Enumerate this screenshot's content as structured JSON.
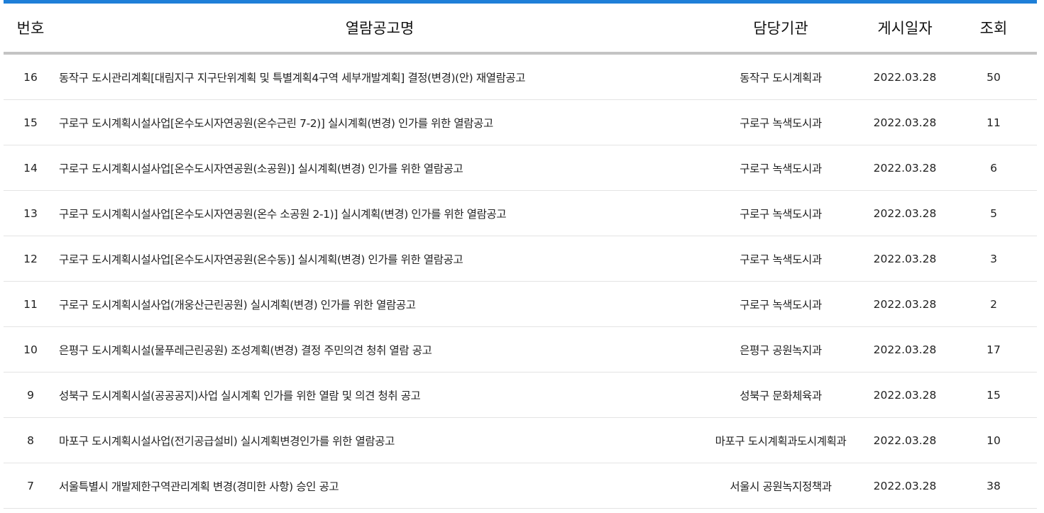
{
  "header": {
    "num": "번호",
    "title": "열람공고명",
    "dept": "담당기관",
    "date": "게시일자",
    "views": "조회"
  },
  "rows": [
    {
      "num": "16",
      "title": "동작구 도시관리계획[대림지구 지구단위계획 및 특별계획4구역 세부개발계획] 결정(변경)(안) 재열람공고",
      "dept": "동작구 도시계획과",
      "date": "2022.03.28",
      "views": "50"
    },
    {
      "num": "15",
      "title": "구로구 도시계획시설사업[온수도시자연공원(온수근린 7-2)] 실시계획(변경) 인가를 위한 열람공고",
      "dept": "구로구 녹색도시과",
      "date": "2022.03.28",
      "views": "11"
    },
    {
      "num": "14",
      "title": "구로구 도시계획시설사업[온수도시자연공원(소공원)] 실시계획(변경) 인가를 위한 열람공고",
      "dept": "구로구 녹색도시과",
      "date": "2022.03.28",
      "views": "6"
    },
    {
      "num": "13",
      "title": "구로구 도시계획시설사업[온수도시자연공원(온수 소공원 2-1)] 실시계획(변경) 인가를 위한 열람공고",
      "dept": "구로구 녹색도시과",
      "date": "2022.03.28",
      "views": "5"
    },
    {
      "num": "12",
      "title": "구로구 도시계획시설사업[온수도시자연공원(온수동)] 실시계획(변경) 인가를 위한 열람공고",
      "dept": "구로구 녹색도시과",
      "date": "2022.03.28",
      "views": "3"
    },
    {
      "num": "11",
      "title": "구로구 도시계획시설사업(개웅산근린공원) 실시계획(변경) 인가를 위한 열람공고",
      "dept": "구로구 녹색도시과",
      "date": "2022.03.28",
      "views": "2"
    },
    {
      "num": "10",
      "title": "은평구 도시계획시설(물푸레근린공원) 조성계획(변경) 결정 주민의견 청취 열람 공고",
      "dept": "은평구 공원녹지과",
      "date": "2022.03.28",
      "views": "17"
    },
    {
      "num": "9",
      "title": "성북구 도시계획시설(공공공지)사업 실시계획 인가를 위한 열람 및 의견 청취 공고",
      "dept": "성북구 문화체육과",
      "date": "2022.03.28",
      "views": "15"
    },
    {
      "num": "8",
      "title": "마포구 도시계획시설사업(전기공급설비) 실시계획변경인가를 위한 열람공고",
      "dept": "마포구 도시계획과도시계획과",
      "date": "2022.03.28",
      "views": "10"
    },
    {
      "num": "7",
      "title": "서울특별시 개발제한구역관리계획 변경(경미한 사항) 승인 공고",
      "dept": "서울시 공원녹지정책과",
      "date": "2022.03.28",
      "views": "38"
    }
  ],
  "colors": {
    "accent": "#1e7fd8",
    "header_rule": "#c4c4c4",
    "row_rule": "#e4e4e4",
    "text": "#222222"
  }
}
